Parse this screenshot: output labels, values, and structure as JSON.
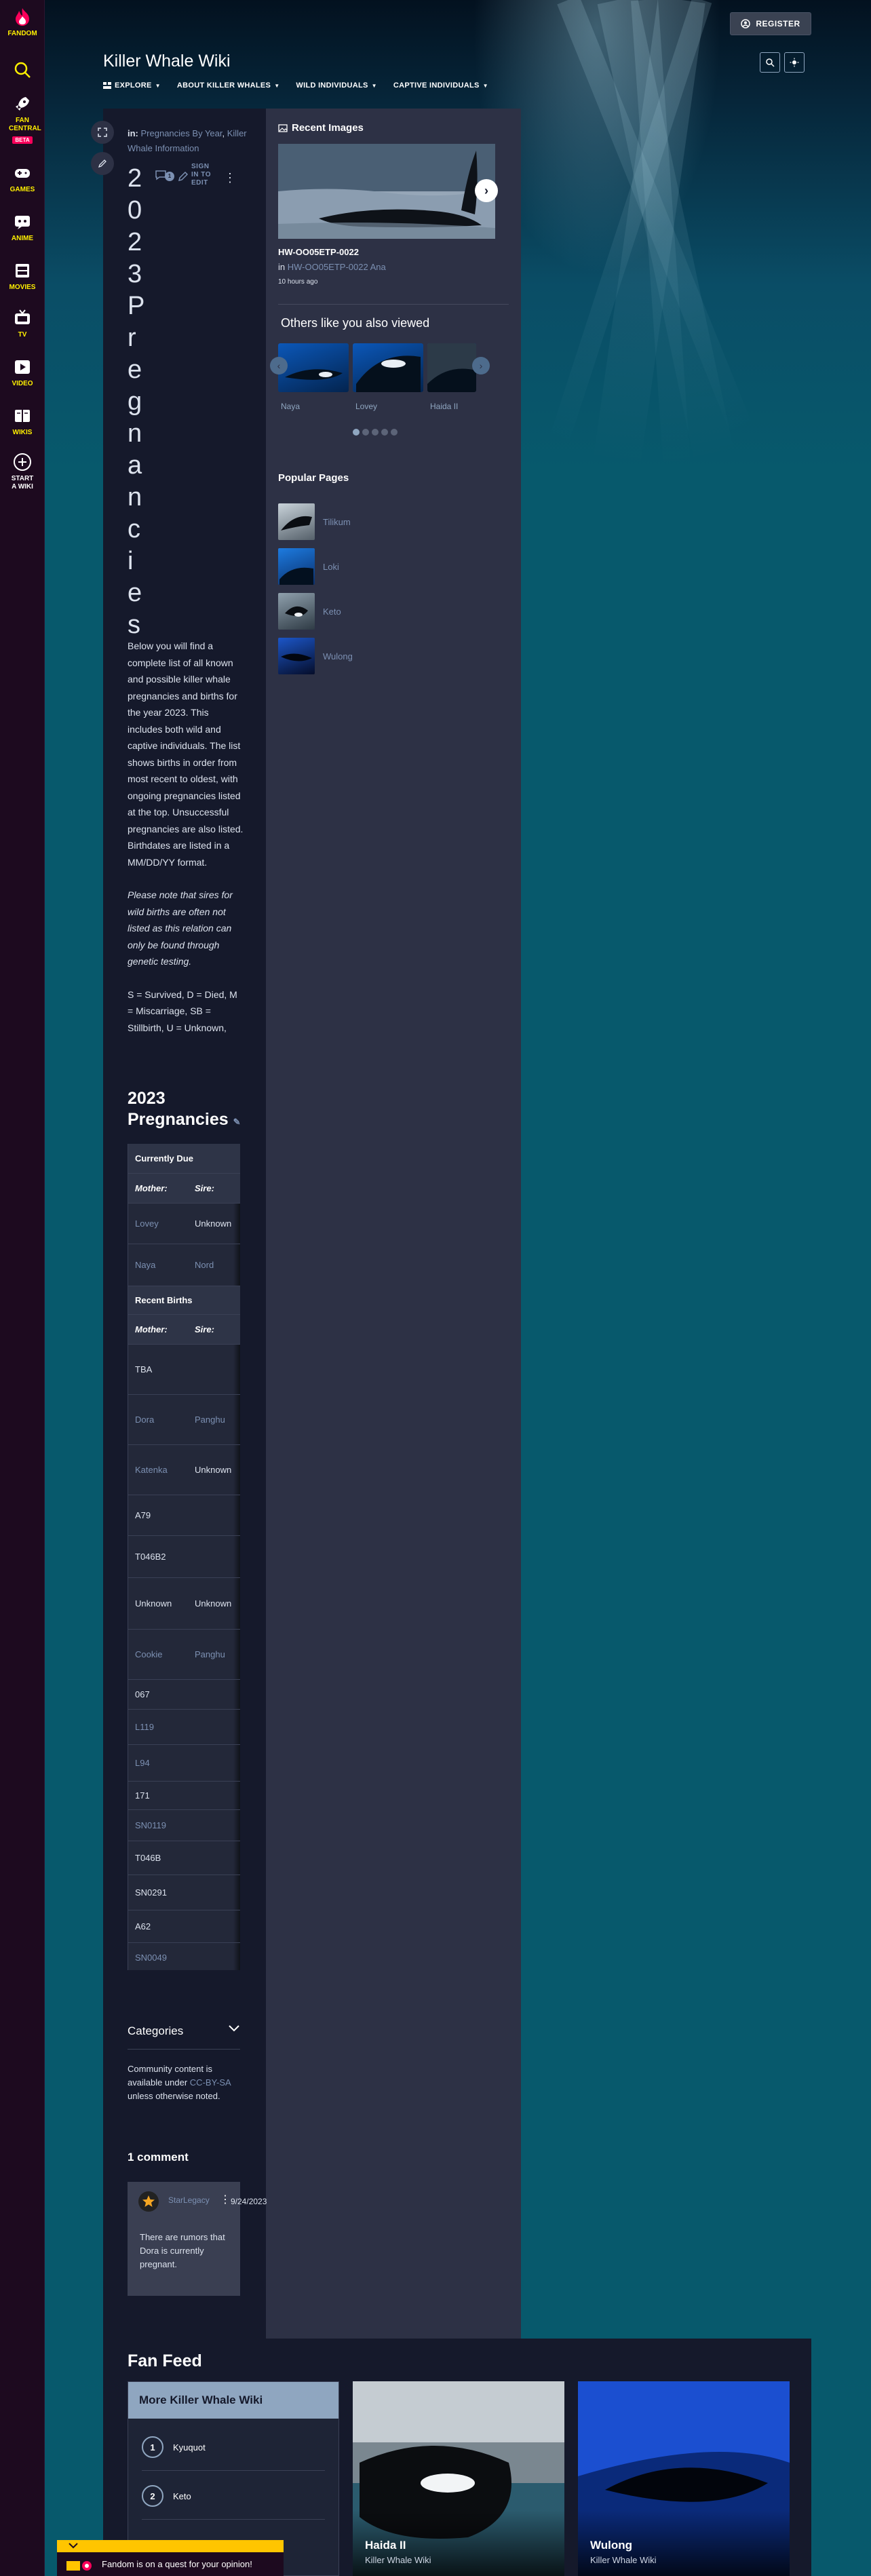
{
  "global_nav": [
    {
      "id": "fandom",
      "label": "FANDOM"
    },
    {
      "id": "search",
      "label": ""
    },
    {
      "id": "fan-central",
      "label": "FAN CENTRAL",
      "badge": "BETA"
    },
    {
      "id": "games",
      "label": "GAMES"
    },
    {
      "id": "anime",
      "label": "ANIME"
    },
    {
      "id": "movies",
      "label": "MOVIES"
    },
    {
      "id": "tv",
      "label": "TV"
    },
    {
      "id": "video",
      "label": "VIDEO"
    },
    {
      "id": "wikis",
      "label": "WIKIS"
    },
    {
      "id": "start",
      "label": "START A WIKI"
    }
  ],
  "header": {
    "register": "REGISTER",
    "wiki_title": "Killer Whale Wiki",
    "nav": [
      "EXPLORE",
      "ABOUT KILLER WHALES",
      "WILD INDIVIDUALS",
      "CAPTIVE INDIVIDUALS"
    ]
  },
  "article": {
    "in_label": "in:",
    "categories": [
      "Pregnancies By Year",
      "Killer Whale Information"
    ],
    "comment_count": "1",
    "sign_in": "SIGN IN TO EDIT",
    "title": "2023 Pregnancies",
    "paragraphs": [
      "Below you will find a complete list of all known and possible killer whale pregnancies and births for the year 2023. This includes both wild and captive individuals. The list shows births in order from most recent to oldest, with ongoing pregnancies listed at the top. Unsuccessful pregnancies are also listed. Birthdates are listed in a MM/DD/YY format."
    ],
    "note": "Please note that sires for wild births are often not listed as this relation can only be found through genetic testing.",
    "legend": "S = Survived, D = Died, M = Miscarriage, SB = Stillbirth, U = Unknown,",
    "section_heading": "2023 Pregnancies"
  },
  "table": {
    "currently_due": "Currently Due",
    "recent_births": "Recent Births",
    "col_mother": "Mother:",
    "col_sire": "Sire:",
    "due_rows": [
      {
        "mother": "Lovey",
        "sire": "Unknown",
        "mlink": true,
        "slink": false
      },
      {
        "mother": "Naya",
        "sire": "Nord",
        "mlink": true,
        "slink": true
      }
    ],
    "birth_rows": [
      {
        "mother": "TBA",
        "sire": "",
        "mlink": false,
        "slink": false
      },
      {
        "mother": "Dora",
        "sire": "Panghu",
        "mlink": true,
        "slink": true
      },
      {
        "mother": "Katenka",
        "sire": "Unknown",
        "mlink": true,
        "slink": false
      },
      {
        "mother": "A79",
        "sire": "",
        "mlink": false,
        "slink": false
      },
      {
        "mother": "T046B2",
        "sire": "",
        "mlink": false,
        "slink": false
      },
      {
        "mother": "Unknown",
        "sire": "Unknown",
        "mlink": false,
        "slink": false
      },
      {
        "mother": "Cookie",
        "sire": "Panghu",
        "mlink": true,
        "slink": true
      },
      {
        "mother": "067",
        "sire": "",
        "mlink": false,
        "slink": false
      },
      {
        "mother": "L119",
        "sire": "",
        "mlink": true,
        "slink": false
      },
      {
        "mother": "L94",
        "sire": "",
        "mlink": true,
        "slink": false
      },
      {
        "mother": "171",
        "sire": "",
        "mlink": false,
        "slink": false
      },
      {
        "mother": "SN0119",
        "sire": "",
        "mlink": true,
        "slink": false
      },
      {
        "mother": "T046B",
        "sire": "",
        "mlink": false,
        "slink": false
      },
      {
        "mother": "SN0291",
        "sire": "",
        "mlink": false,
        "slink": false
      },
      {
        "mother": "A62",
        "sire": "",
        "mlink": false,
        "slink": false
      },
      {
        "mother": "SN0049",
        "sire": "",
        "mlink": true,
        "slink": false
      }
    ]
  },
  "footer_article": {
    "categories_label": "Categories",
    "license_pre": "Community content is available under ",
    "license_link": "CC-BY-SA",
    "license_post": " unless otherwise noted.",
    "comments_heading": "1 comment",
    "comment": {
      "user": "StarLegacy",
      "date": "9/24/2023",
      "body": "There are rumors that Dora is currently pregnant."
    }
  },
  "rail": {
    "recent_images_heading": "Recent Images",
    "recent_image_title": "HW-OO05ETP-0022",
    "recent_image_in": "in",
    "recent_image_page": "HW-OO05ETP-0022 Ana",
    "recent_image_time": "10 hours ago",
    "others_heading": "Others like you also viewed",
    "others": [
      "Naya",
      "Lovey",
      "Haida II"
    ],
    "popular_heading": "Popular Pages",
    "popular": [
      "Tilikum",
      "Loki",
      "Keto",
      "Wulong"
    ]
  },
  "fan_feed": {
    "title": "Fan Feed",
    "list_heading": "More Killer Whale Wiki",
    "list": [
      {
        "n": "1",
        "label": "Kyuquot"
      },
      {
        "n": "2",
        "label": "Keto"
      }
    ],
    "cards": [
      {
        "title": "Haida II",
        "sub": "Killer Whale Wiki"
      },
      {
        "title": "Wulong",
        "sub": "Killer Whale Wiki"
      }
    ]
  },
  "toast": "Fandom is on a quest for your opinion!",
  "colors": {
    "link": "#7c90b2",
    "fandom_yellow": "#fff000",
    "fandom_pink": "#fa005a",
    "page_bg": "#15192b",
    "rail_bg": "#2d3145"
  }
}
